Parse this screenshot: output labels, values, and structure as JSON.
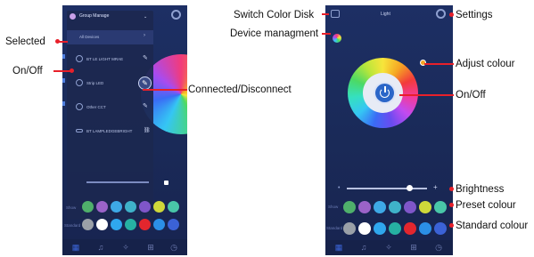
{
  "annotations": {
    "selected": "Selected",
    "on_off_left": "On/Off",
    "connected_disconnect": "Connected/Disconnect",
    "switch_color_disk": "Switch Color Disk",
    "device_management": "Device managment",
    "settings": "Settings",
    "adjust_colour": "Adjust colour",
    "on_off_right": "On/Off",
    "brightness": "Brightness",
    "preset_colour": "Preset colour",
    "standard_colour": "Standard colour"
  },
  "left_screen": {
    "group_title": "Group Manage",
    "devices": [
      "All Devices",
      "BT LE LIGHT MRAE",
      "Strip LED",
      "Other CCT",
      "BT LAMPLEDGEBRIGHT"
    ],
    "row_labels": [
      "Show",
      "Standard"
    ]
  },
  "right_screen": {
    "title": "Light",
    "row_labels": [
      "Show",
      "Standard"
    ],
    "preset_colours": [
      "#4fb06b",
      "#9b63c8",
      "#3ea9e6",
      "#3fb2c9",
      "#7f56c9",
      "#cfd83a",
      "#49c6a8"
    ],
    "standard_colours": [
      "#9aa0a8",
      "#ffffff",
      "#2fa7ee",
      "#26b1a3",
      "#e3262e",
      "#2b8fe6",
      "#3b62d6"
    ],
    "brightness_level": 0.78
  },
  "colors": {
    "accent_red": "#e8202a",
    "phone_bg": "#1d2f64",
    "button_blue": "#2b66c8"
  }
}
